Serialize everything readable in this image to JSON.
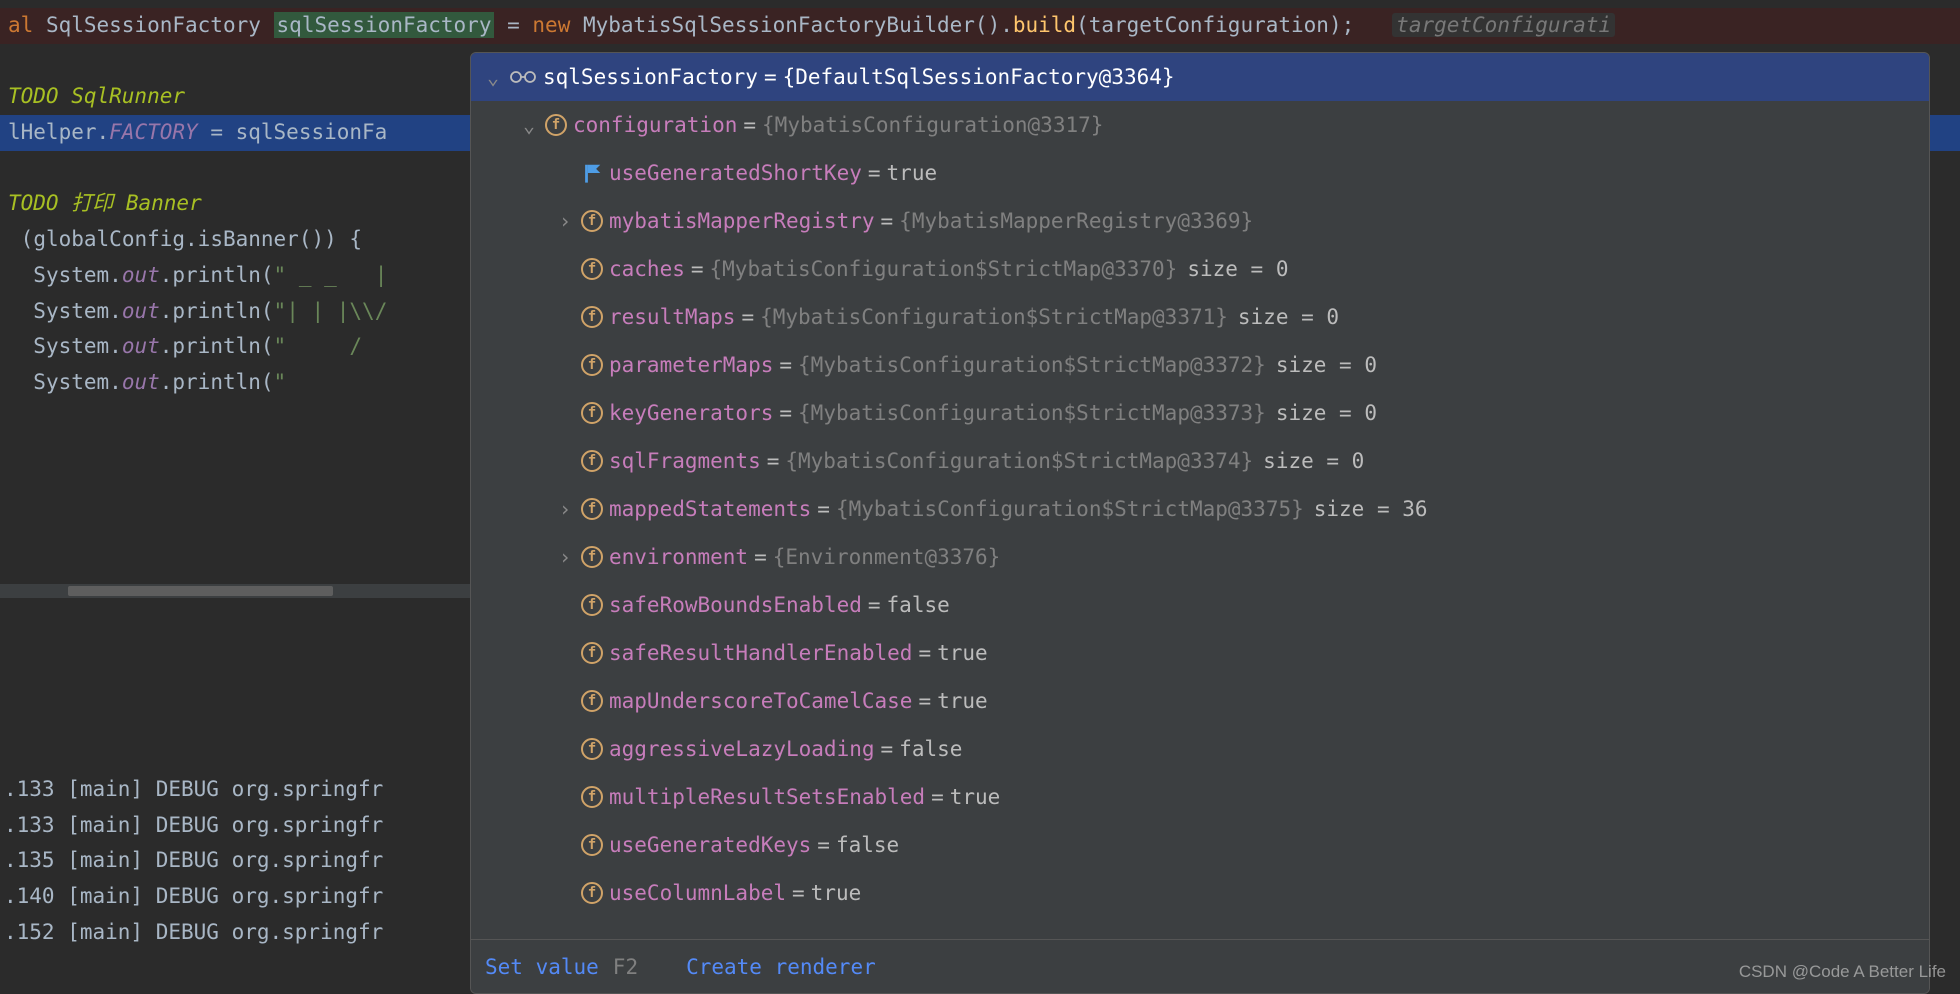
{
  "editor": {
    "line1": {
      "prefix": "al ",
      "type": "SqlSessionFactory",
      "var": "sqlSessionFactory",
      "eq": " = ",
      "newkw": "new",
      "builder": " MybatisSqlSessionFactoryBuilder().",
      "method": "build",
      "args": "(targetConfiguration);",
      "hint": "targetConfigurati"
    },
    "line2": {
      "comment": "TODO SqlRunner"
    },
    "line3": {
      "pre": "lHelper.",
      "factory": "FACTORY",
      "eq": " = sqlSessionFa"
    },
    "line4": {
      "comment": "TODO 打印 Banner"
    },
    "line5": {
      "pre": "(",
      "var": "globalConfig",
      "post": ".isBanner()) {"
    },
    "line6": {
      "sys": "System.",
      "out": "out",
      "call": ".println(",
      "str": "\" _ _   |"
    },
    "line7": {
      "sys": "System.",
      "out": "out",
      "call": ".println(",
      "str": "\"| | |\\\\/"
    },
    "line8": {
      "sys": "System.",
      "out": "out",
      "call": ".println(",
      "str": "\"     /"
    },
    "line9": {
      "sys": "System.",
      "out": "out",
      "call": ".println(",
      "str": "\""
    }
  },
  "console": {
    "l1": ".133 [main] DEBUG org.springfr",
    "l2": ".133 [main] DEBUG org.springfr",
    "l3": ".135 [main] DEBUG org.springfr",
    "l4": ".140 [main] DEBUG org.springfr",
    "l5": ".152 [main] DEBUG org.springfr"
  },
  "tree": {
    "root": {
      "name": "sqlSessionFactory",
      "val": "{DefaultSqlSessionFactory@3364}"
    },
    "config": {
      "name": "configuration",
      "ref": "{MybatisConfiguration@3317}"
    },
    "useGenShort": {
      "name": "useGeneratedShortKey",
      "val": "true"
    },
    "mapperReg": {
      "name": "mybatisMapperRegistry",
      "ref": "{MybatisMapperRegistry@3369}"
    },
    "caches": {
      "name": "caches",
      "ref": "{MybatisConfiguration$StrictMap@3370}",
      "extra": "size = 0"
    },
    "resultMaps": {
      "name": "resultMaps",
      "ref": "{MybatisConfiguration$StrictMap@3371}",
      "extra": "size = 0"
    },
    "paramMaps": {
      "name": "parameterMaps",
      "ref": "{MybatisConfiguration$StrictMap@3372}",
      "extra": "size = 0"
    },
    "keyGen": {
      "name": "keyGenerators",
      "ref": "{MybatisConfiguration$StrictMap@3373}",
      "extra": "size = 0"
    },
    "sqlFrag": {
      "name": "sqlFragments",
      "ref": "{MybatisConfiguration$StrictMap@3374}",
      "extra": "size = 0"
    },
    "mappedStmt": {
      "name": "mappedStatements",
      "ref": "{MybatisConfiguration$StrictMap@3375}",
      "extra": "size = 36"
    },
    "env": {
      "name": "environment",
      "ref": "{Environment@3376}"
    },
    "safeRow": {
      "name": "safeRowBoundsEnabled",
      "val": "false"
    },
    "safeResult": {
      "name": "safeResultHandlerEnabled",
      "val": "true"
    },
    "mapUnderscore": {
      "name": "mapUnderscoreToCamelCase",
      "val": "true"
    },
    "aggLazy": {
      "name": "aggressiveLazyLoading",
      "val": "false"
    },
    "multiResult": {
      "name": "multipleResultSetsEnabled",
      "val": "true"
    },
    "useGenKeys": {
      "name": "useGeneratedKeys",
      "val": "false"
    },
    "useColLabel": {
      "name": "useColumnLabel",
      "val": "true"
    }
  },
  "footer": {
    "setValue": "Set value",
    "key": "F2",
    "createRenderer": "Create renderer"
  },
  "watermark": "CSDN @Code A Better Life"
}
